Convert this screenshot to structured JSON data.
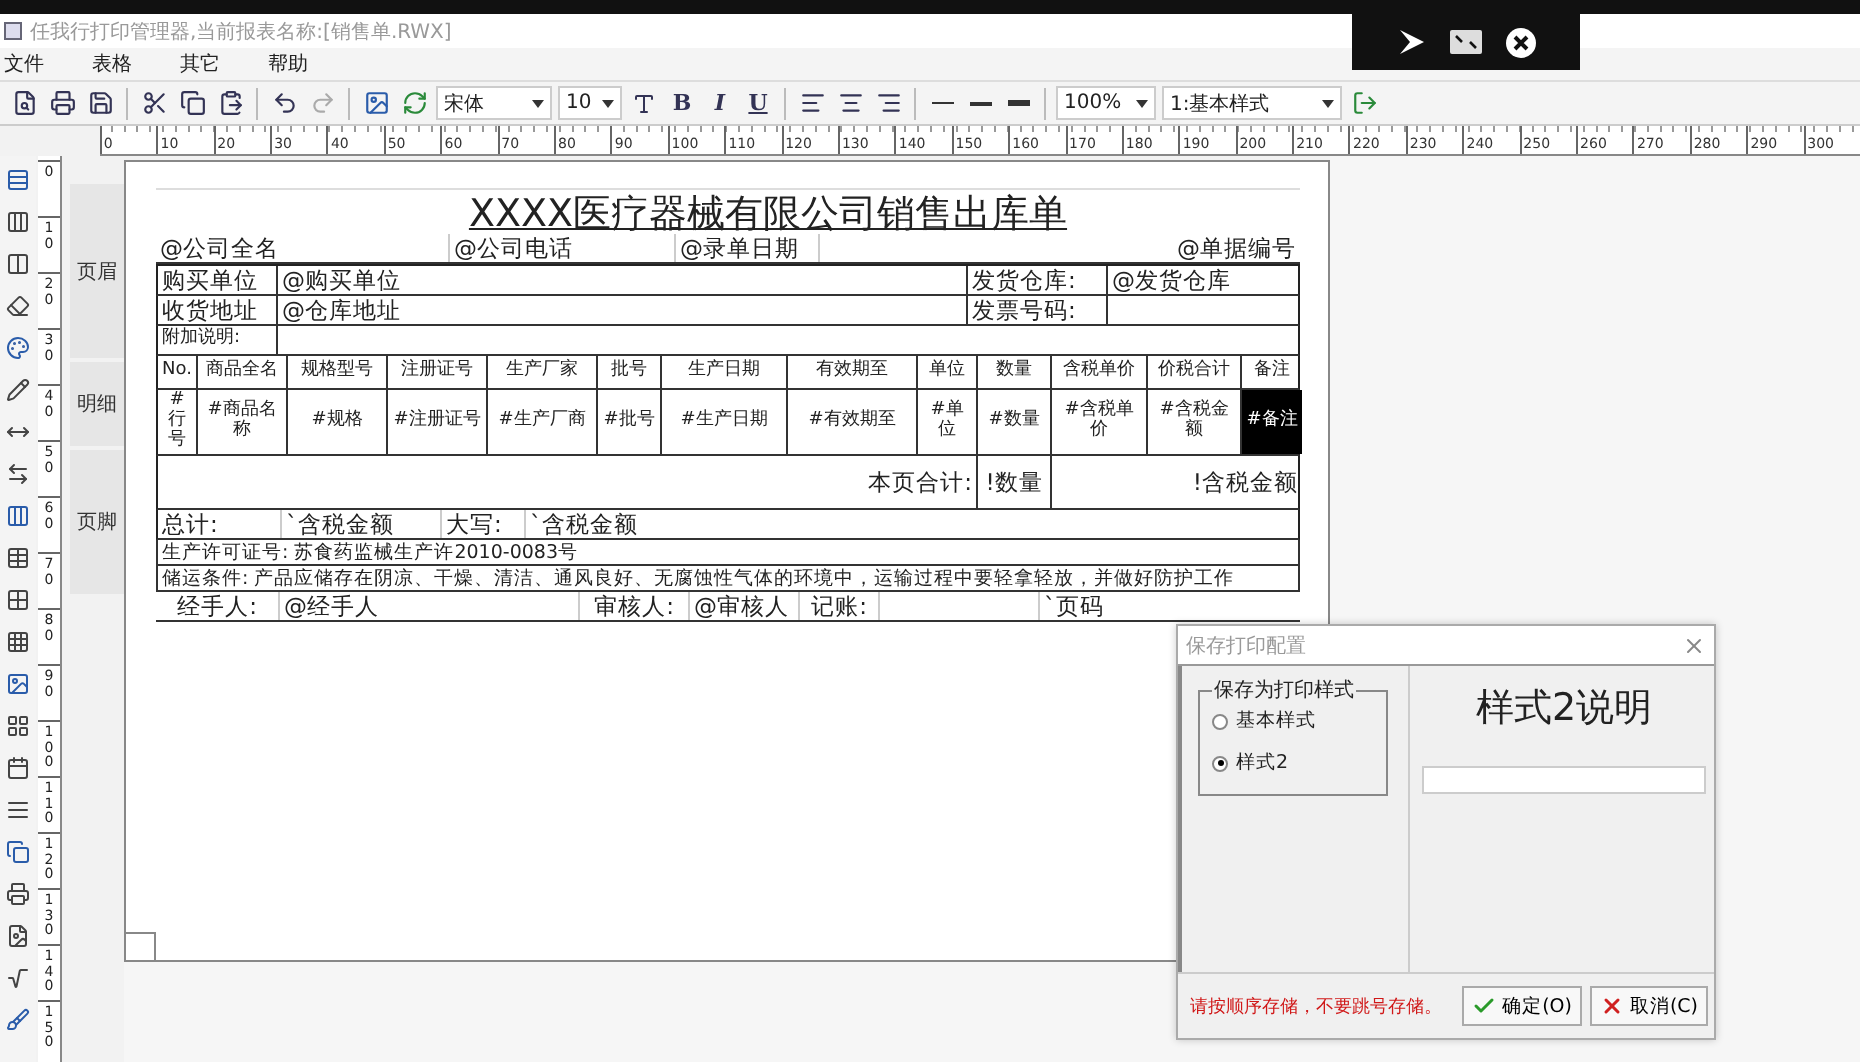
{
  "window": {
    "title": "任我行打印管理器,当前报表名称:[销售单.RWX]"
  },
  "menu": [
    "文件",
    "表格",
    "其它",
    "帮助"
  ],
  "toolbar": {
    "font": "宋体",
    "size": "10",
    "format": [
      "B",
      "I",
      "U"
    ],
    "zoom": "100%",
    "style": "1:基本样式"
  },
  "h_ruler": [
    "0",
    "10",
    "20",
    "30",
    "40",
    "50",
    "60",
    "70",
    "80",
    "90",
    "100",
    "110",
    "120",
    "130",
    "140",
    "150",
    "160",
    "170",
    "180",
    "190",
    "200",
    "210",
    "220",
    "230",
    "240",
    "250",
    "260",
    "270",
    "280",
    "290",
    "300"
  ],
  "v_ruler": [
    "0",
    "10",
    "20",
    "30",
    "40",
    "50",
    "60",
    "70",
    "80",
    "90",
    "100",
    "110",
    "120",
    "130",
    "140",
    "150"
  ],
  "sections": [
    "页眉",
    "明细",
    "页脚"
  ],
  "report": {
    "title": "XXXX医疗器械有限公司销售出库单",
    "info": [
      "@公司全名",
      "@公司电话",
      "@录单日期",
      "@单据编号"
    ],
    "parties": [
      {
        "label": "购买单位",
        "value": "@购买单位",
        "label2": "发货仓库:",
        "value2": "@发货仓库"
      },
      {
        "label": "收货地址",
        "value": "@仓库地址",
        "label2": "发票号码:"
      }
    ],
    "note_label": "附加说明:",
    "columns": [
      "No.",
      "商品全名",
      "规格型号",
      "注册证号",
      "生产厂家",
      "批号",
      "生产日期",
      "有效期至",
      "单位",
      "数量",
      "含税单价",
      "价税合计",
      "备注"
    ],
    "detail": [
      {
        "text": "#行号",
        "selected": false
      },
      {
        "text": "#商品名称",
        "selected": false
      },
      {
        "text": "#规格",
        "selected": false
      },
      {
        "text": "#注册证号",
        "selected": false
      },
      {
        "text": "#生产厂商",
        "selected": false
      },
      {
        "text": "#批号",
        "selected": false
      },
      {
        "text": "#生产日期",
        "selected": false
      },
      {
        "text": "#有效期至",
        "selected": false
      },
      {
        "text": "#单位",
        "selected": false
      },
      {
        "text": "#数量",
        "selected": false
      },
      {
        "text": "#含税单价",
        "selected": false
      },
      {
        "text": "#含税金额",
        "selected": false
      },
      {
        "text": "#备注",
        "selected": true
      }
    ],
    "page_total": {
      "label": "本页合计:",
      "quantity": "!数量",
      "amount": "!含税金额"
    },
    "total": [
      "总计:",
      "`含税金额",
      "大写:",
      "`含税金额"
    ],
    "license": "生产许可证号: 苏食药监械生产许2010-0083号",
    "storage": "储运条件: 产品应储存在阴凉、干燥、清洁、通风良好、无腐蚀性气体的环境中，运输过程中要轻拿轻放，并做好防护工作",
    "signers": [
      "经手人:",
      "@经手人",
      "审核人:",
      "@审核人",
      "记账:",
      "`页码"
    ]
  },
  "dialog": {
    "title": "保存打印配置",
    "group": "保存为打印样式",
    "options": [
      {
        "label": "基本样式",
        "selected": false
      },
      {
        "label": "样式2",
        "selected": true
      }
    ],
    "description": "样式2说明",
    "note": "请按顺序存储，不要跳号存储。",
    "buttons": [
      {
        "kind": "ok",
        "label": "确定(O)"
      },
      {
        "kind": "cancel",
        "label": "取消(C)"
      }
    ]
  }
}
